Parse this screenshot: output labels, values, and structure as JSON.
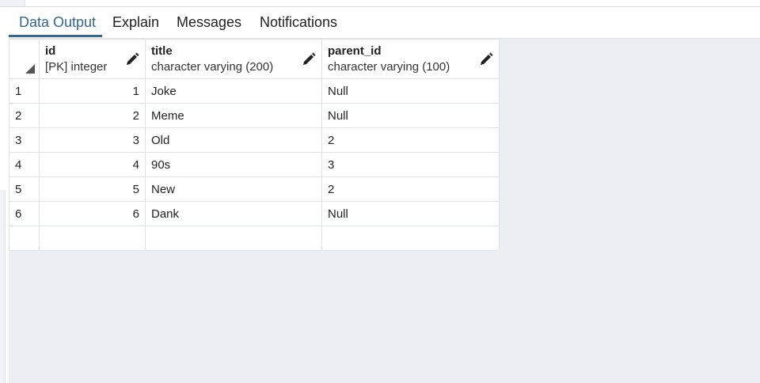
{
  "tabs": [
    {
      "label": "Data Output"
    },
    {
      "label": "Explain"
    },
    {
      "label": "Messages"
    },
    {
      "label": "Notifications"
    }
  ],
  "active_tab": "Data Output",
  "columns": [
    {
      "name": "id",
      "type": "[PK] integer",
      "edit_icon": "pencil-icon"
    },
    {
      "name": "title",
      "type": "character varying (200)",
      "edit_icon": "pencil-icon"
    },
    {
      "name": "parent_id",
      "type": "character varying (100)",
      "edit_icon": "pencil-icon"
    }
  ],
  "rows": [
    {
      "rownum": "1",
      "id": "1",
      "title": "Joke",
      "parent_id": "Null"
    },
    {
      "rownum": "2",
      "id": "2",
      "title": "Meme",
      "parent_id": "Null"
    },
    {
      "rownum": "3",
      "id": "3",
      "title": "Old",
      "parent_id": "2"
    },
    {
      "rownum": "4",
      "id": "4",
      "title": "90s",
      "parent_id": "3"
    },
    {
      "rownum": "5",
      "id": "5",
      "title": "New",
      "parent_id": "2"
    },
    {
      "rownum": "6",
      "id": "6",
      "title": "Dank",
      "parent_id": "Null"
    }
  ],
  "colors": {
    "accent": "#326690",
    "grid_background": "#ebeef2",
    "border": "#dde2e8"
  }
}
